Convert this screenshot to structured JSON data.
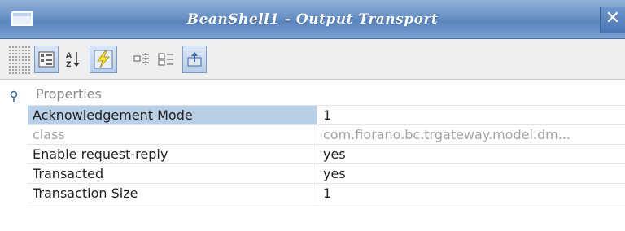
{
  "window": {
    "title": "BeanShell1 - Output Transport",
    "close_glyph": "✕"
  },
  "toolbar": {
    "buttons": [
      {
        "name": "categorized-view-icon",
        "pressed": true
      },
      {
        "name": "sort-alphabetical-icon",
        "pressed": false
      },
      {
        "name": "lightning-icon",
        "pressed": true
      },
      {
        "name": "show-description-icon",
        "pressed": false
      },
      {
        "name": "expand-all-icon",
        "pressed": false
      },
      {
        "name": "export-icon",
        "pressed": true
      }
    ]
  },
  "section": {
    "label": "Properties"
  },
  "properties": [
    {
      "name": "Acknowledgement Mode",
      "value": "1",
      "selected": true,
      "disabled": false
    },
    {
      "name": "class",
      "value": "com.fiorano.bc.trgateway.model.dm...",
      "selected": false,
      "disabled": true
    },
    {
      "name": "Enable request-reply",
      "value": "yes",
      "selected": false,
      "disabled": false
    },
    {
      "name": "Transacted",
      "value": "yes",
      "selected": false,
      "disabled": false
    },
    {
      "name": "Transaction Size",
      "value": "1",
      "selected": false,
      "disabled": false
    }
  ],
  "colors": {
    "title_bar": "#6a92c6",
    "selection": "#b8cfe6",
    "disabled_text": "#a4a4a4"
  }
}
